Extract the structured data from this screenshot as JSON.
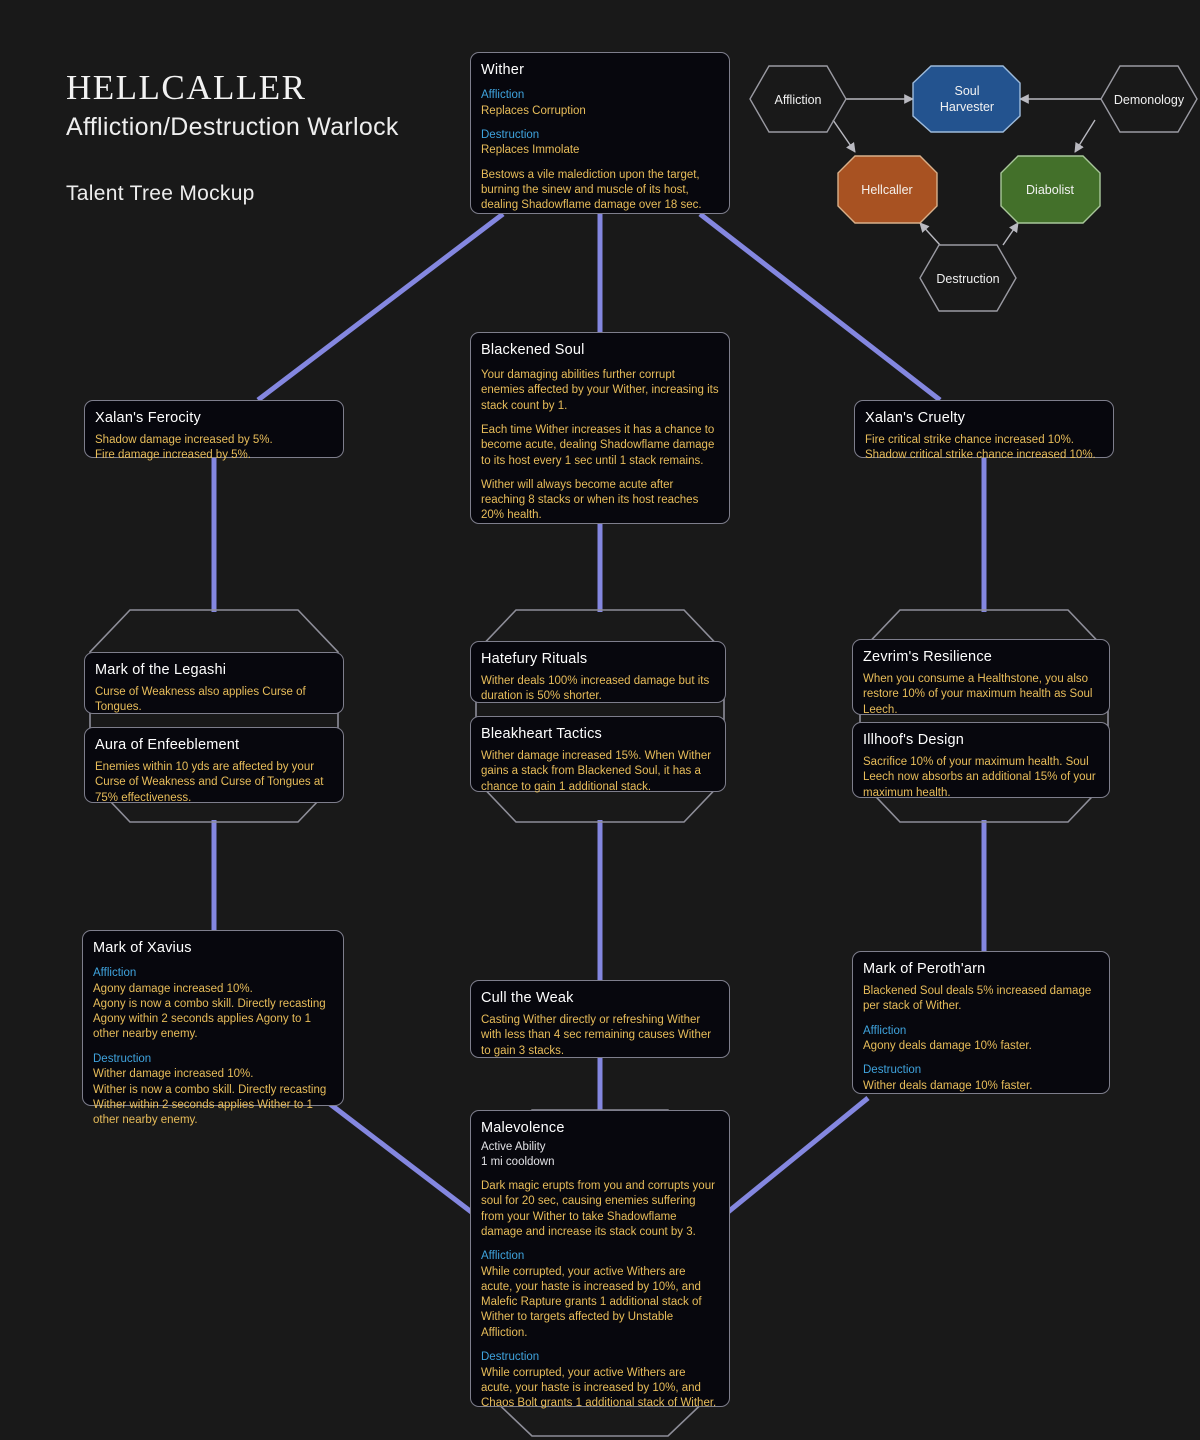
{
  "header": {
    "title": "HELLCALLER",
    "subtitle": "Affliction/Destruction Warlock",
    "note": "Talent Tree Mockup"
  },
  "colors": {
    "background": "#191919",
    "node_fill": "#07070d",
    "node_border": "#7e7e8c",
    "connector": "#8487e0",
    "spec_blue": "#3fa3dd",
    "body_gold": "#e8bd5a",
    "title_white": "#ffffff",
    "hero_soul_harvester": "#23538f",
    "hero_hellcaller": "#a85222",
    "hero_diabolist": "#43702a",
    "hero_outline": "#9a9aa2"
  },
  "hero_tree": {
    "nodes": [
      {
        "id": "affliction",
        "label": "Affliction",
        "shape": "hexagon",
        "fill": "none",
        "selected": false
      },
      {
        "id": "soul-harvester",
        "label": "Soul\nHarvester",
        "shape": "octagon",
        "fill": "#23538f",
        "selected": true
      },
      {
        "id": "demonology",
        "label": "Demonology",
        "shape": "hexagon",
        "fill": "none",
        "selected": false
      },
      {
        "id": "hellcaller",
        "label": "Hellcaller",
        "shape": "octagon",
        "fill": "#a85222",
        "selected": true
      },
      {
        "id": "diabolist",
        "label": "Diabolist",
        "shape": "octagon",
        "fill": "#43702a",
        "selected": true
      },
      {
        "id": "destruction",
        "label": "Destruction",
        "shape": "hexagon",
        "fill": "none",
        "selected": false
      }
    ],
    "edges": [
      {
        "from": "affliction",
        "to": "soul-harvester"
      },
      {
        "from": "demonology",
        "to": "soul-harvester"
      },
      {
        "from": "affliction",
        "to": "hellcaller"
      },
      {
        "from": "demonology",
        "to": "diabolist"
      },
      {
        "from": "destruction",
        "to": "hellcaller"
      },
      {
        "from": "destruction",
        "to": "diabolist"
      }
    ]
  },
  "talents": {
    "wither": {
      "title": "Wither",
      "spec1": "Affliction",
      "spec1_text": "Replaces Corruption",
      "spec2": "Destruction",
      "spec2_text": "Replaces Immolate",
      "body": "Bestows a vile malediction upon the target, burning the sinew and muscle of its host, dealing Shadowflame damage over 18 sec."
    },
    "xalans_ferocity": {
      "title": "Xalan's Ferocity",
      "body": "Shadow damage increased by 5%.\nFire damage increased by 5%."
    },
    "blackened_soul": {
      "title": "Blackened Soul",
      "p1": "Your damaging abilities further corrupt enemies affected by your Wither, increasing its stack count by 1.",
      "p2": "Each time Wither increases it has a chance to become acute, dealing Shadowflame damage to its host every 1 sec until 1 stack remains.",
      "p3": "Wither will always become acute after reaching 8 stacks or when its host reaches 20% health."
    },
    "xalans_cruelty": {
      "title": "Xalan's Cruelty",
      "body": "Fire critical strike chance increased 10%. Shadow critical strike chance increased 10%."
    },
    "mark_of_the_legashi": {
      "title": "Mark of the Legashi",
      "body": "Curse of Weakness also applies Curse of Tongues."
    },
    "aura_of_enfeeblement": {
      "title": "Aura of Enfeeblement",
      "body": "Enemies within 10 yds are affected by your Curse of Weakness and Curse of Tongues at 75% effectiveness."
    },
    "hatefury_rituals": {
      "title": "Hatefury Rituals",
      "body": "Wither deals 100% increased damage but its duration is 50% shorter."
    },
    "bleakheart_tactics": {
      "title": "Bleakheart Tactics",
      "body": "Wither damage increased 15%. When Wither gains a stack from Blackened Soul, it has a chance to gain 1 additional stack."
    },
    "zevrims_resilience": {
      "title": "Zevrim's Resilience",
      "body": "When you consume a Healthstone, you also restore 10% of your maximum health as Soul Leech."
    },
    "illhoofs_design": {
      "title": "Illhoof's Design",
      "body": "Sacrifice 10% of your maximum health. Soul Leech now absorbs an additional 15% of your maximum health."
    },
    "mark_of_xavius": {
      "title": "Mark of Xavius",
      "spec1": "Affliction",
      "spec1_text": "Agony damage increased 10%.\nAgony is now a combo skill. Directly recasting Agony within 2 seconds applies Agony to 1 other nearby enemy.",
      "spec2": "Destruction",
      "spec2_text": "Wither damage increased 10%.\nWither is now a combo skill. Directly recasting Wither within 2 seconds applies Wither to 1 other nearby enemy."
    },
    "cull_the_weak": {
      "title": "Cull the Weak",
      "body": "Casting Wither directly or refreshing Wither with less than 4 sec remaining causes Wither to gain 3 stacks."
    },
    "mark_of_perotharn": {
      "title": "Mark of Peroth'arn",
      "body": "Blackened Soul deals 5% increased damage per stack of Wither.",
      "spec1": "Affliction",
      "spec1_text": "Agony deals damage 10% faster.",
      "spec2": "Destruction",
      "spec2_text": "Wither deals damage 10% faster."
    },
    "malevolence": {
      "title": "Malevolence",
      "sub1": "Active Ability",
      "sub2": "1 mi cooldown",
      "body": "Dark magic erupts from you and corrupts your soul for 20 sec, causing enemies suffering from your Wither to take Shadowflame damage and increase its stack count by 3.",
      "spec1": "Affliction",
      "spec1_text": "While corrupted, your active Withers are acute, your haste is increased by 10%, and Malefic Rapture grants 1 additional stack of Wither to targets affected by Unstable Affliction.",
      "spec2": "Destruction",
      "spec2_text": "While corrupted, your active Withers are acute, your haste is increased by 10%, and Chaos Bolt grants 1 additional stack of Wither."
    }
  }
}
